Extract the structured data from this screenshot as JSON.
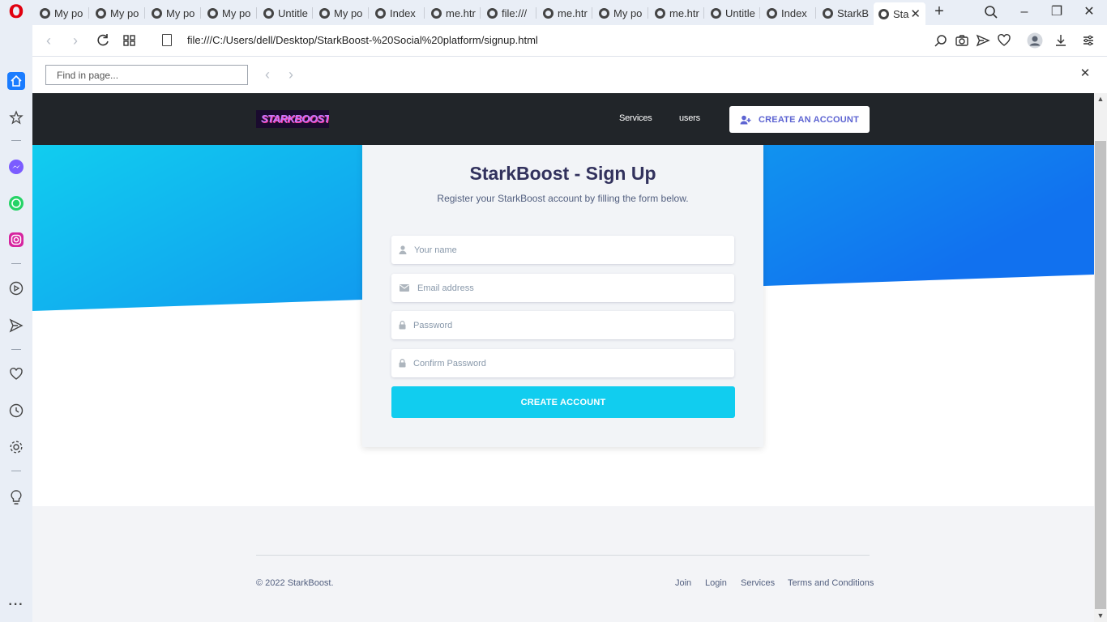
{
  "browser": {
    "tabs": [
      {
        "label": "My po"
      },
      {
        "label": "My po"
      },
      {
        "label": "My po"
      },
      {
        "label": "My po"
      },
      {
        "label": "Untitle"
      },
      {
        "label": "My po"
      },
      {
        "label": "Index"
      },
      {
        "label": "me.htr"
      },
      {
        "label": "file:///"
      },
      {
        "label": "me.htr"
      },
      {
        "label": "My po"
      },
      {
        "label": "me.htr"
      },
      {
        "label": "Untitle"
      },
      {
        "label": "Index"
      },
      {
        "label": "StarkB"
      },
      {
        "label": "Sta"
      }
    ],
    "url": "file:///C:/Users/dell/Desktop/StarkBoost-%20Social%20platform/signup.html",
    "find_placeholder": "Find in page...",
    "colors": {
      "chrome": "#e9eef6",
      "opera_red": "#e1000f"
    }
  },
  "site": {
    "logo_text": "STARKBOOST",
    "nav": {
      "services": "Services",
      "users": "users",
      "cta": "CREATE AN ACCOUNT"
    },
    "card": {
      "title": "StarkBoost - Sign Up",
      "subtitle": "Register your StarkBoost account by filling the form below.",
      "name_placeholder": "Your name",
      "email_placeholder": "Email address",
      "password_placeholder": "Password",
      "confirm_placeholder": "Confirm Password",
      "submit": "CREATE ACCOUNT"
    },
    "footer": {
      "copyright": "© 2022 StarkBoost.",
      "links": [
        "Join",
        "Login",
        "Services",
        "Terms and Conditions"
      ]
    },
    "colors": {
      "navbar": "#212529",
      "hero_start": "#11cdef",
      "hero_end": "#1171ef",
      "primary_button": "#11cdef",
      "cta_text": "#5d64d2",
      "heading": "#32325d"
    }
  }
}
